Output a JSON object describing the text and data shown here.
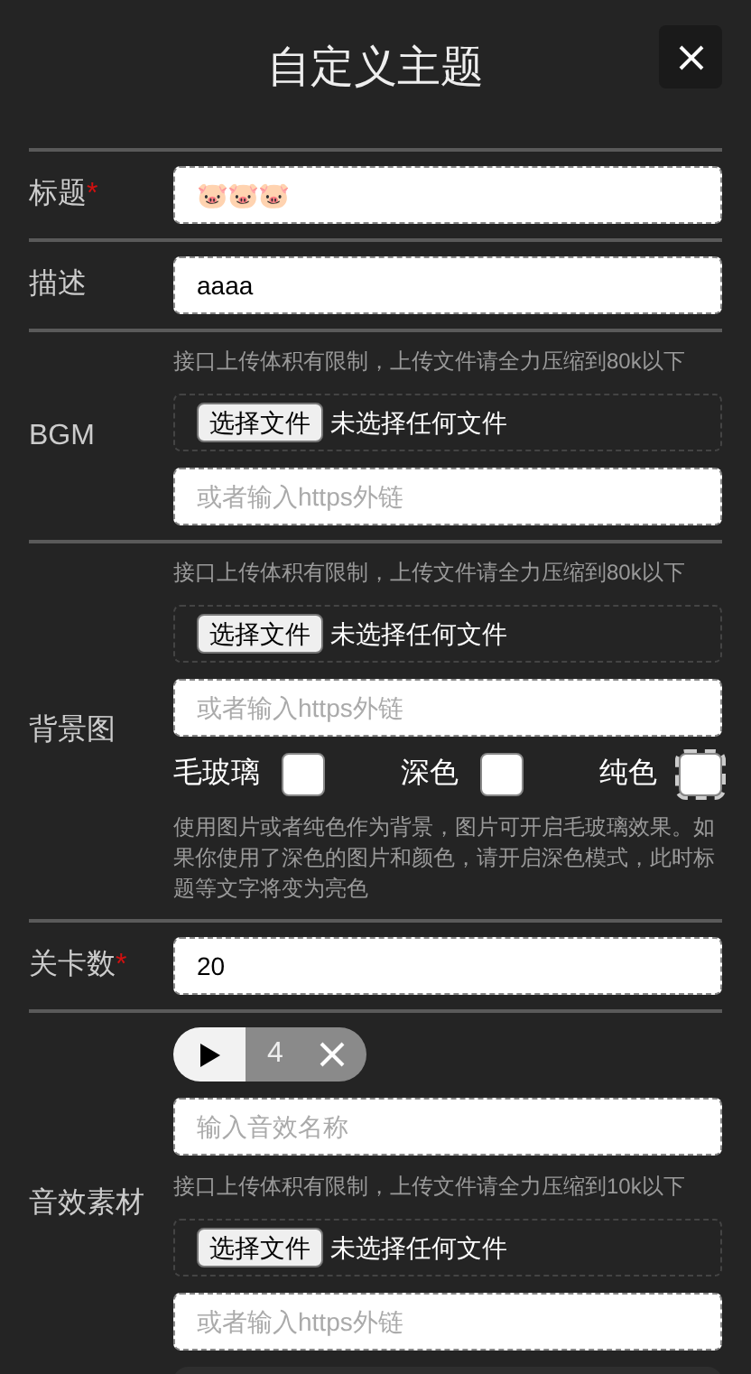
{
  "title": "自定义主题",
  "sections": [
    {
      "label": "标题",
      "mark": "*",
      "items": [
        {
          "kind": "input",
          "value": "🐷🐷🐷"
        }
      ]
    },
    {
      "label": "描述",
      "items": [
        {
          "kind": "input",
          "value": "aaaa"
        }
      ]
    },
    {
      "label": "BGM",
      "items": [
        {
          "kind": "hint",
          "text": "接口上传体积有限制，上传文件请全力压缩到80k以下"
        },
        {
          "kind": "file",
          "button": "选择文件",
          "status": "未选择任何文件"
        },
        {
          "kind": "input",
          "placeholder": "或者输入https外链"
        }
      ]
    },
    {
      "label": "背景图",
      "items": [
        {
          "kind": "hint",
          "text": "接口上传体积有限制，上传文件请全力压缩到80k以下"
        },
        {
          "kind": "file",
          "button": "选择文件",
          "status": "未选择任何文件"
        },
        {
          "kind": "input",
          "placeholder": "或者输入https外链"
        },
        {
          "kind": "checkboxes",
          "options": [
            {
              "label": "毛玻璃",
              "checked": false
            },
            {
              "label": "深色",
              "checked": false
            },
            {
              "label": "纯色",
              "checked": false
            }
          ]
        },
        {
          "kind": "hint",
          "text": "使用图片或者纯色作为背景，图片可开启毛玻璃效果。如果你使用了深色的图片和颜色，请开启深色模式，此时标题等文字将变为亮色"
        }
      ]
    },
    {
      "label": "关卡数",
      "mark": "*",
      "items": [
        {
          "kind": "input",
          "value": "20"
        }
      ]
    },
    {
      "label": "音效素材",
      "items": [
        {
          "kind": "chip",
          "text": "4"
        },
        {
          "kind": "input",
          "placeholder": "输入音效名称"
        },
        {
          "kind": "hint",
          "text": "接口上传体积有限制，上传文件请全力压缩到10k以下"
        },
        {
          "kind": "file",
          "button": "选择文件",
          "status": "未选择任何文件"
        },
        {
          "kind": "input",
          "placeholder": "或者输入https外链"
        },
        {
          "kind": "panel"
        }
      ]
    }
  ]
}
